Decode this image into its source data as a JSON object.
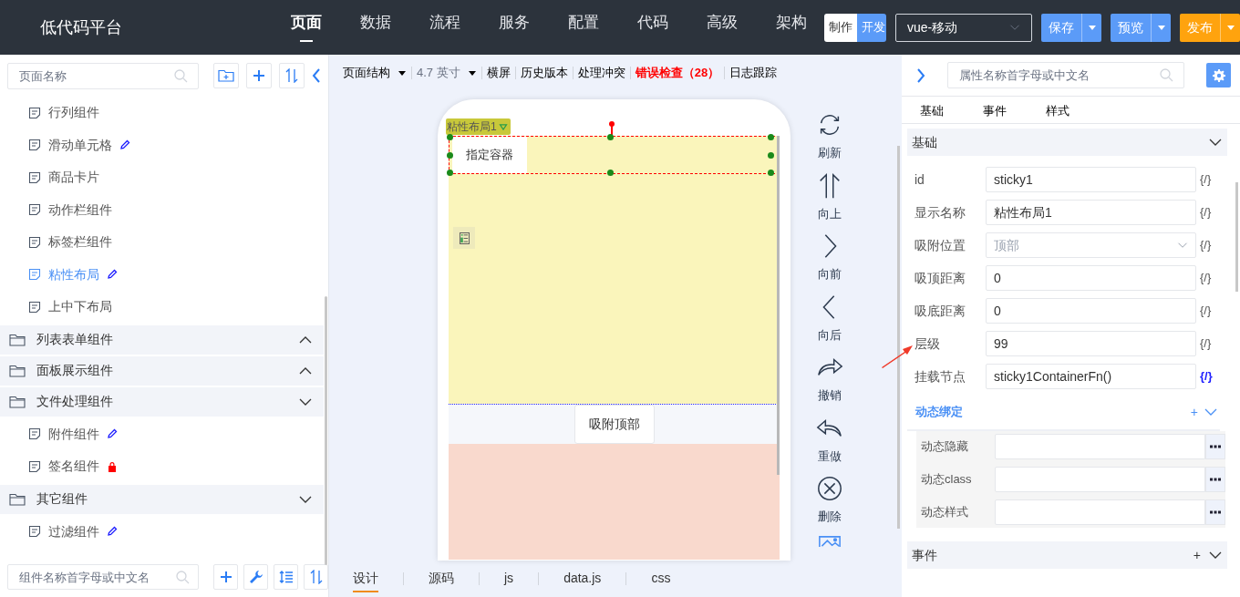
{
  "header": {
    "logo": "低代码平台",
    "nav": [
      {
        "label": "页面",
        "selected": true
      },
      {
        "label": "数据",
        "selected": false
      },
      {
        "label": "流程",
        "selected": false
      },
      {
        "label": "服务",
        "selected": false
      },
      {
        "label": "配置",
        "selected": false
      },
      {
        "label": "代码",
        "selected": false
      },
      {
        "label": "高级",
        "selected": false
      },
      {
        "label": "架构",
        "selected": false
      }
    ],
    "mode_toggle": [
      {
        "label": "制作",
        "selected": false
      },
      {
        "label": "开发",
        "selected": true
      }
    ],
    "platform_select": {
      "value": "vue-移动"
    },
    "actions": [
      {
        "label": "保存",
        "kind": "primary"
      },
      {
        "label": "预览",
        "kind": "primary"
      },
      {
        "label": "发布",
        "kind": "warning"
      }
    ]
  },
  "sidebar": {
    "search": {
      "placeholder": "页面名称"
    },
    "tree": [
      {
        "label": "行列组件",
        "kind": "component",
        "selected": false,
        "editing": false,
        "locked": false
      },
      {
        "label": "滑动单元格",
        "kind": "component",
        "selected": false,
        "editing": true,
        "locked": false
      },
      {
        "label": "商品卡片",
        "kind": "component",
        "selected": false,
        "editing": false,
        "locked": false
      },
      {
        "label": "动作栏组件",
        "kind": "component",
        "selected": false,
        "editing": false,
        "locked": false
      },
      {
        "label": "标签栏组件",
        "kind": "component",
        "selected": false,
        "editing": false,
        "locked": false
      },
      {
        "label": "粘性布局",
        "kind": "component",
        "selected": true,
        "editing": true,
        "locked": false
      },
      {
        "label": "上中下布局",
        "kind": "component",
        "selected": false,
        "editing": false,
        "locked": false
      },
      {
        "label": "列表表单组件",
        "kind": "folder",
        "expanded": false
      },
      {
        "label": "面板展示组件",
        "kind": "folder",
        "expanded": false
      },
      {
        "label": "文件处理组件",
        "kind": "folder",
        "expanded": true,
        "children": [
          {
            "label": "附件组件",
            "kind": "component",
            "selected": false,
            "editing": true,
            "locked": false
          },
          {
            "label": "签名组件",
            "kind": "component",
            "selected": false,
            "editing": false,
            "locked": true
          }
        ]
      },
      {
        "label": "其它组件",
        "kind": "folder",
        "expanded": true,
        "children": [
          {
            "label": "过滤组件",
            "kind": "component",
            "selected": false,
            "editing": true,
            "locked": false
          }
        ]
      }
    ],
    "component_search": {
      "placeholder": "组件名称首字母或中文名"
    }
  },
  "canvas": {
    "toolbar": [
      {
        "label": "页面结构",
        "kind": "dropdown"
      },
      {
        "label": "4.7 英寸",
        "kind": "dropdown-muted"
      },
      {
        "label": "横屏",
        "kind": "link"
      },
      {
        "label": "历史版本",
        "kind": "link"
      },
      {
        "label": "处理冲突",
        "kind": "link"
      },
      {
        "label": "错误检查（28）",
        "kind": "error"
      },
      {
        "label": "日志跟踪",
        "kind": "link"
      }
    ],
    "selection_label": "粘性布局1",
    "container_label": "指定容器",
    "sticky_button": "吸附顶部",
    "side_actions": [
      {
        "kind": "refresh",
        "label": "刷新"
      },
      {
        "kind": "up",
        "label": "向上"
      },
      {
        "kind": "forward",
        "label": "向前"
      },
      {
        "kind": "back",
        "label": "向后"
      },
      {
        "kind": "undo",
        "label": "撤销"
      },
      {
        "kind": "redo",
        "label": "重做"
      },
      {
        "kind": "delete",
        "label": "删除"
      },
      {
        "kind": "image"
      }
    ],
    "bottom_tabs": [
      {
        "label": "设计",
        "selected": true
      },
      {
        "label": "源码",
        "selected": false
      },
      {
        "label": "js",
        "selected": false
      },
      {
        "label": "data.js",
        "selected": false
      },
      {
        "label": "css",
        "selected": false
      }
    ]
  },
  "properties": {
    "search": {
      "placeholder": "属性名称首字母或中文名"
    },
    "tabs": [
      "基础",
      "事件",
      "样式"
    ],
    "basic": {
      "title": "基础",
      "expanded": true,
      "fields": [
        {
          "label": "id",
          "value": "sticky1",
          "kind": "text",
          "disabled": false,
          "binding": "{/}",
          "bound": false
        },
        {
          "label": "显示名称",
          "value": "粘性布局1",
          "kind": "text",
          "disabled": false,
          "binding": "{/}",
          "bound": false
        },
        {
          "label": "吸附位置",
          "value": "顶部",
          "kind": "select",
          "disabled": true,
          "binding": "{/}",
          "bound": false
        },
        {
          "label": "吸顶距离",
          "value": "0",
          "kind": "text",
          "disabled": false,
          "binding": "{/}",
          "bound": false
        },
        {
          "label": "吸底距离",
          "value": "0",
          "kind": "text",
          "disabled": false,
          "binding": "{/}",
          "bound": false
        },
        {
          "label": "层级",
          "value": "99",
          "kind": "text",
          "disabled": false,
          "binding": "{/}",
          "bound": false
        },
        {
          "label": "挂载节点",
          "value": "sticky1ContainerFn()",
          "kind": "text",
          "disabled": false,
          "binding": "{/}",
          "bound": true
        }
      ]
    },
    "dynamic": {
      "title": "动态绑定",
      "add": "+",
      "fields": [
        {
          "label": "动态隐藏"
        },
        {
          "label": "动态class"
        },
        {
          "label": "动态样式"
        }
      ]
    },
    "events": {
      "title": "事件",
      "add": "+",
      "expanded": true
    }
  }
}
